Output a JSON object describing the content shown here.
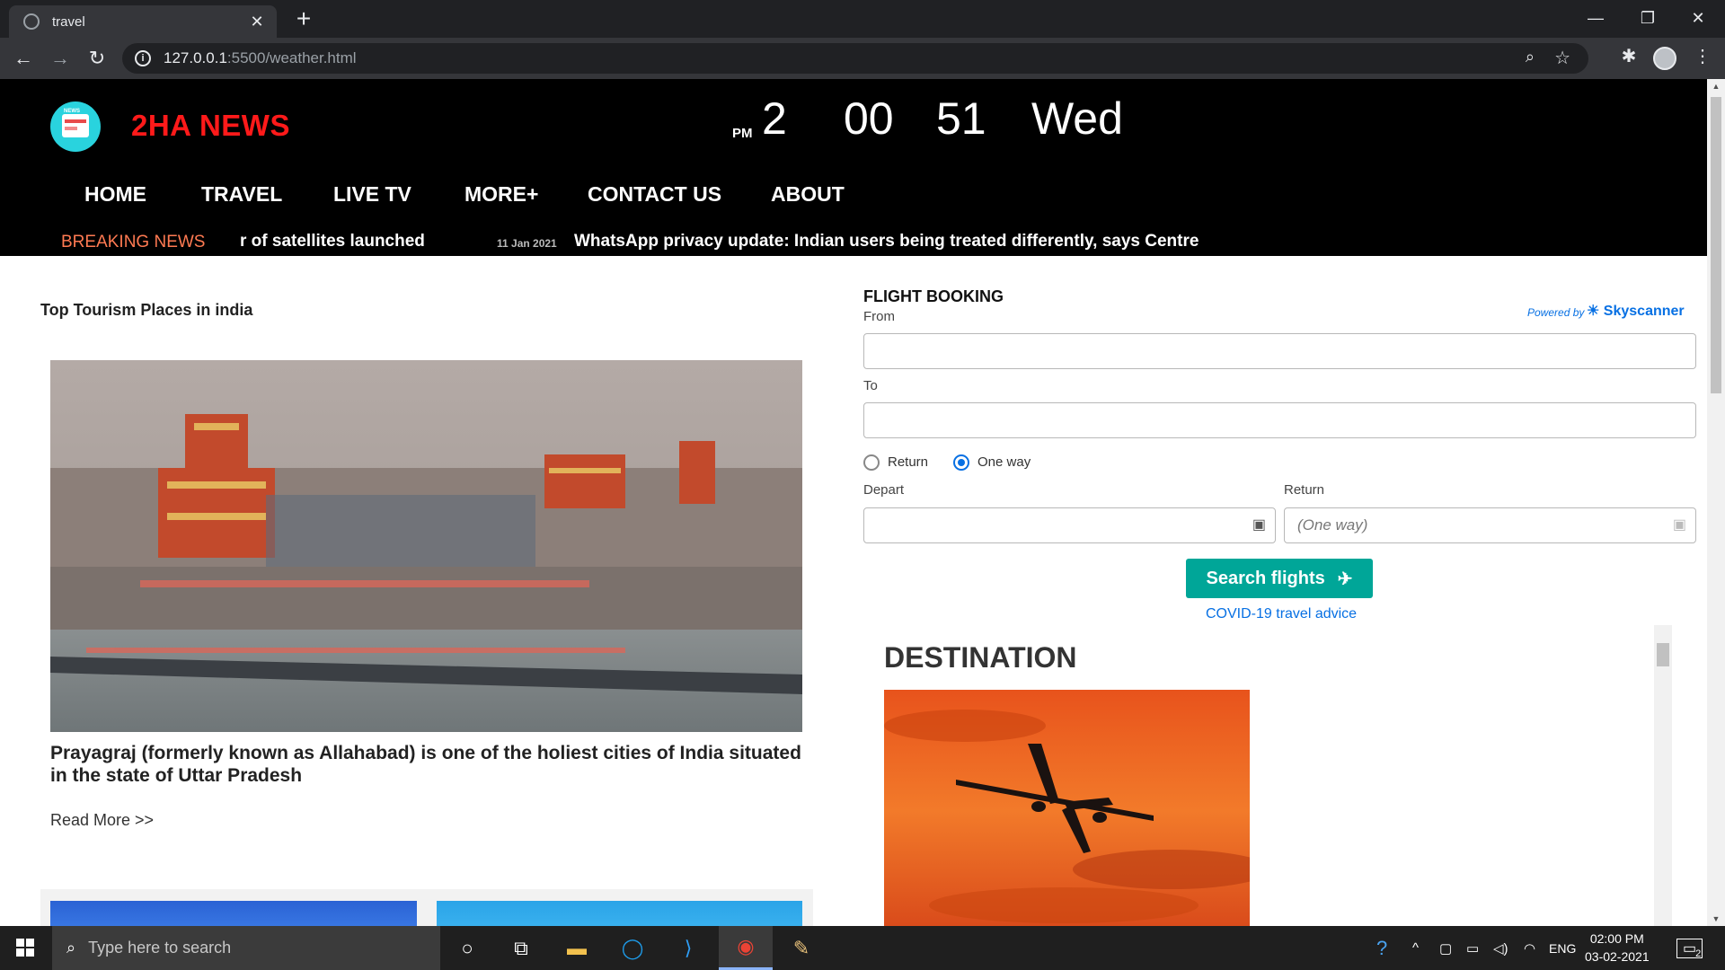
{
  "browser": {
    "tab_title": "travel",
    "url_host": "127.0.0.1",
    "url_path": ":5500/weather.html"
  },
  "site": {
    "brand": "2HA NEWS",
    "logo_tag": "NEWS",
    "clock": {
      "ampm": "PM",
      "hour": "2",
      "minute": "00",
      "second": "51",
      "day": "Wed"
    },
    "nav": [
      "HOME",
      "TRAVEL",
      "LIVE TV",
      "MORE+",
      "CONTACT US",
      "ABOUT"
    ],
    "breaking_label": "BREAKING NEWS",
    "ticker": {
      "item1": "r of satellites launched",
      "date": "11 Jan 2021",
      "item2": "WhatsApp privacy update: Indian users being treated differently, says Centre"
    }
  },
  "left": {
    "section_title": "Top Tourism Places in india",
    "hero_caption": "Prayagraj (formerly known as Allahabad) is one of the holiest cities of India situated in the state of Uttar Pradesh",
    "read_more": "Read More >>"
  },
  "flight": {
    "title": "FLIGHT BOOKING",
    "powered_by": "Powered by",
    "provider": "Skyscanner",
    "from_label": "From",
    "to_label": "To",
    "from_value": "",
    "to_value": "",
    "trip_types": [
      "Return",
      "One way"
    ],
    "selected_trip": "One way",
    "depart_label": "Depart",
    "return_label": "Return",
    "return_placeholder": "(One way)",
    "search_label": "Search flights",
    "covid_link": "COVID-19 travel advice"
  },
  "destination": {
    "title": "DESTINATION"
  },
  "taskbar": {
    "search_placeholder": "Type here to search",
    "lang": "ENG",
    "time": "02:00 PM",
    "date": "03-02-2021",
    "notifications": "2"
  },
  "colors": {
    "brand_red": "#ff1a1a",
    "breaking_orange": "#ff7a52",
    "skyscanner_blue": "#0770e3",
    "search_teal": "#00a698"
  }
}
